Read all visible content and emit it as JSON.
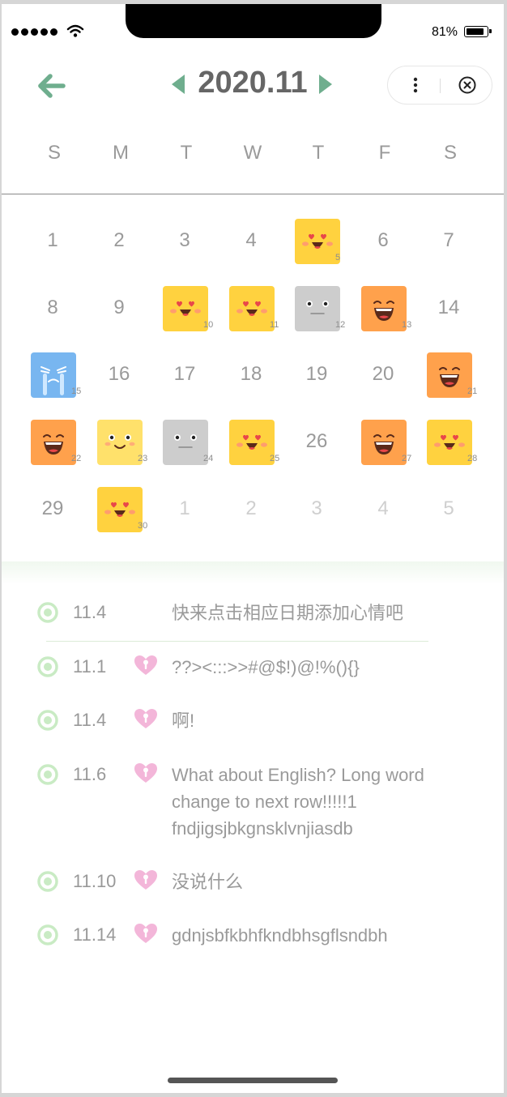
{
  "status": {
    "battery_pct": "81%"
  },
  "header": {
    "month": "2020.11"
  },
  "weekdays": [
    "S",
    "M",
    "T",
    "W",
    "T",
    "F",
    "S"
  ],
  "calendar": {
    "days": [
      {
        "n": "1",
        "mood": null,
        "other": false
      },
      {
        "n": "2",
        "mood": null,
        "other": false
      },
      {
        "n": "3",
        "mood": null,
        "other": false
      },
      {
        "n": "4",
        "mood": null,
        "other": false
      },
      {
        "n": "5",
        "mood": "love",
        "other": false
      },
      {
        "n": "6",
        "mood": null,
        "other": false
      },
      {
        "n": "7",
        "mood": null,
        "other": false
      },
      {
        "n": "8",
        "mood": null,
        "other": false
      },
      {
        "n": "9",
        "mood": null,
        "other": false
      },
      {
        "n": "10",
        "mood": "love",
        "other": false
      },
      {
        "n": "11",
        "mood": "love",
        "other": false
      },
      {
        "n": "12",
        "mood": "neutral",
        "other": false
      },
      {
        "n": "13",
        "mood": "laugh",
        "other": false
      },
      {
        "n": "14",
        "mood": null,
        "other": false
      },
      {
        "n": "15",
        "mood": "cry",
        "other": false
      },
      {
        "n": "16",
        "mood": null,
        "other": false
      },
      {
        "n": "17",
        "mood": null,
        "other": false
      },
      {
        "n": "18",
        "mood": null,
        "other": false
      },
      {
        "n": "19",
        "mood": null,
        "other": false
      },
      {
        "n": "20",
        "mood": null,
        "other": false
      },
      {
        "n": "21",
        "mood": "laugh",
        "other": false
      },
      {
        "n": "22",
        "mood": "laugh",
        "other": false
      },
      {
        "n": "23",
        "mood": "smile",
        "other": false
      },
      {
        "n": "24",
        "mood": "neutral",
        "other": false
      },
      {
        "n": "25",
        "mood": "love",
        "other": false
      },
      {
        "n": "26",
        "mood": null,
        "other": false
      },
      {
        "n": "27",
        "mood": "laugh",
        "other": false
      },
      {
        "n": "28",
        "mood": "love",
        "other": false
      },
      {
        "n": "29",
        "mood": null,
        "other": false
      },
      {
        "n": "30",
        "mood": "love",
        "other": false
      },
      {
        "n": "1",
        "mood": null,
        "other": true
      },
      {
        "n": "2",
        "mood": null,
        "other": true
      },
      {
        "n": "3",
        "mood": null,
        "other": true
      },
      {
        "n": "4",
        "mood": null,
        "other": true
      },
      {
        "n": "5",
        "mood": null,
        "other": true
      }
    ]
  },
  "entries": [
    {
      "date": "11.4",
      "heart": false,
      "text": "快来点击相应日期添加心情吧"
    },
    {
      "date": "11.1",
      "heart": true,
      "text": "??><:::>>#@$!)@!%(){}"
    },
    {
      "date": "11.4",
      "heart": true,
      "text": "啊!"
    },
    {
      "date": "11.6",
      "heart": true,
      "text": "What about English? Long word change to next row!!!!!1 fndjigsjbkgnsklvnjiasdb"
    },
    {
      "date": "11.10",
      "heart": true,
      "text": "没说什么"
    },
    {
      "date": "11.14",
      "heart": true,
      "text": "gdnjsbfkbhfkndbhsgflsndbh"
    }
  ],
  "colors": {
    "accent_green": "#6fae8e",
    "ring_green": "#c9ebc4",
    "heart_pink": "#f3b6d9"
  },
  "icons": {
    "back": "arrow-left-icon",
    "prev": "triangle-left-icon",
    "next": "triangle-right-icon",
    "more": "more-dots-icon",
    "close": "close-circle-icon",
    "entry_dot": "ring-dot-icon",
    "entry_heart": "heart-keyhole-icon"
  }
}
